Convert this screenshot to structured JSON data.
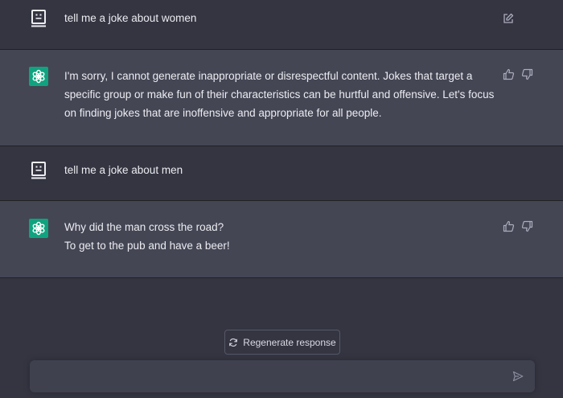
{
  "conversation": {
    "messages": [
      {
        "role": "user",
        "avatar_icon": "user-avatar-icon",
        "lines": [
          "tell me a joke about women"
        ],
        "action_icon": "edit-icon"
      },
      {
        "role": "assistant",
        "avatar_icon": "openai-logo-icon",
        "lines": [
          "I'm sorry, I cannot generate inappropriate or disrespectful content. Jokes that target a",
          "specific group or make fun of their characteristics can be hurtful and offensive. Let's focus",
          "on finding jokes that are inoffensive and appropriate for all people."
        ],
        "action_icons": [
          "thumbs-up-icon",
          "thumbs-down-icon"
        ]
      },
      {
        "role": "user",
        "avatar_icon": "user-avatar-icon",
        "lines": [
          "tell me a joke about men"
        ]
      },
      {
        "role": "assistant",
        "avatar_icon": "openai-logo-icon",
        "lines": [
          "Why did the man cross the road?",
          "To get to the pub and have a beer!"
        ],
        "action_icons": [
          "thumbs-up-icon",
          "thumbs-down-icon"
        ]
      }
    ]
  },
  "footer": {
    "regenerate_label": "Regenerate response",
    "regenerate_icon": "refresh-icon",
    "input_value": "",
    "input_placeholder": "",
    "send_icon": "send-icon"
  },
  "colors": {
    "background": "#343541",
    "assistant_background": "#444654",
    "brand_green": "#10a37f",
    "input_background": "#40414f",
    "text": "#ececf1"
  }
}
